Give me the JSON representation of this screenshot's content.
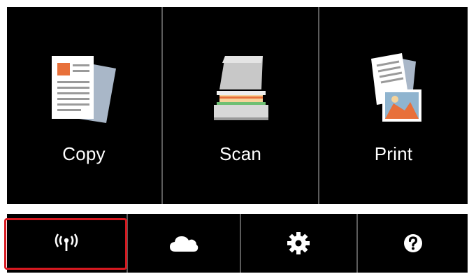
{
  "home": {
    "tiles": [
      {
        "label": "Copy",
        "icon": "copy-icon"
      },
      {
        "label": "Scan",
        "icon": "scan-icon"
      },
      {
        "label": "Print",
        "icon": "print-icon"
      }
    ]
  },
  "bottom_bar": {
    "buttons": [
      {
        "icon": "wireless-lan-icon",
        "highlighted": true
      },
      {
        "icon": "cloud-icon",
        "highlighted": false
      },
      {
        "icon": "settings-icon",
        "highlighted": false
      },
      {
        "icon": "help-icon",
        "highlighted": false
      }
    ]
  },
  "colors": {
    "background": "#000000",
    "divider": "#5b5b5b",
    "highlight": "#d71920",
    "text": "#ffffff"
  }
}
